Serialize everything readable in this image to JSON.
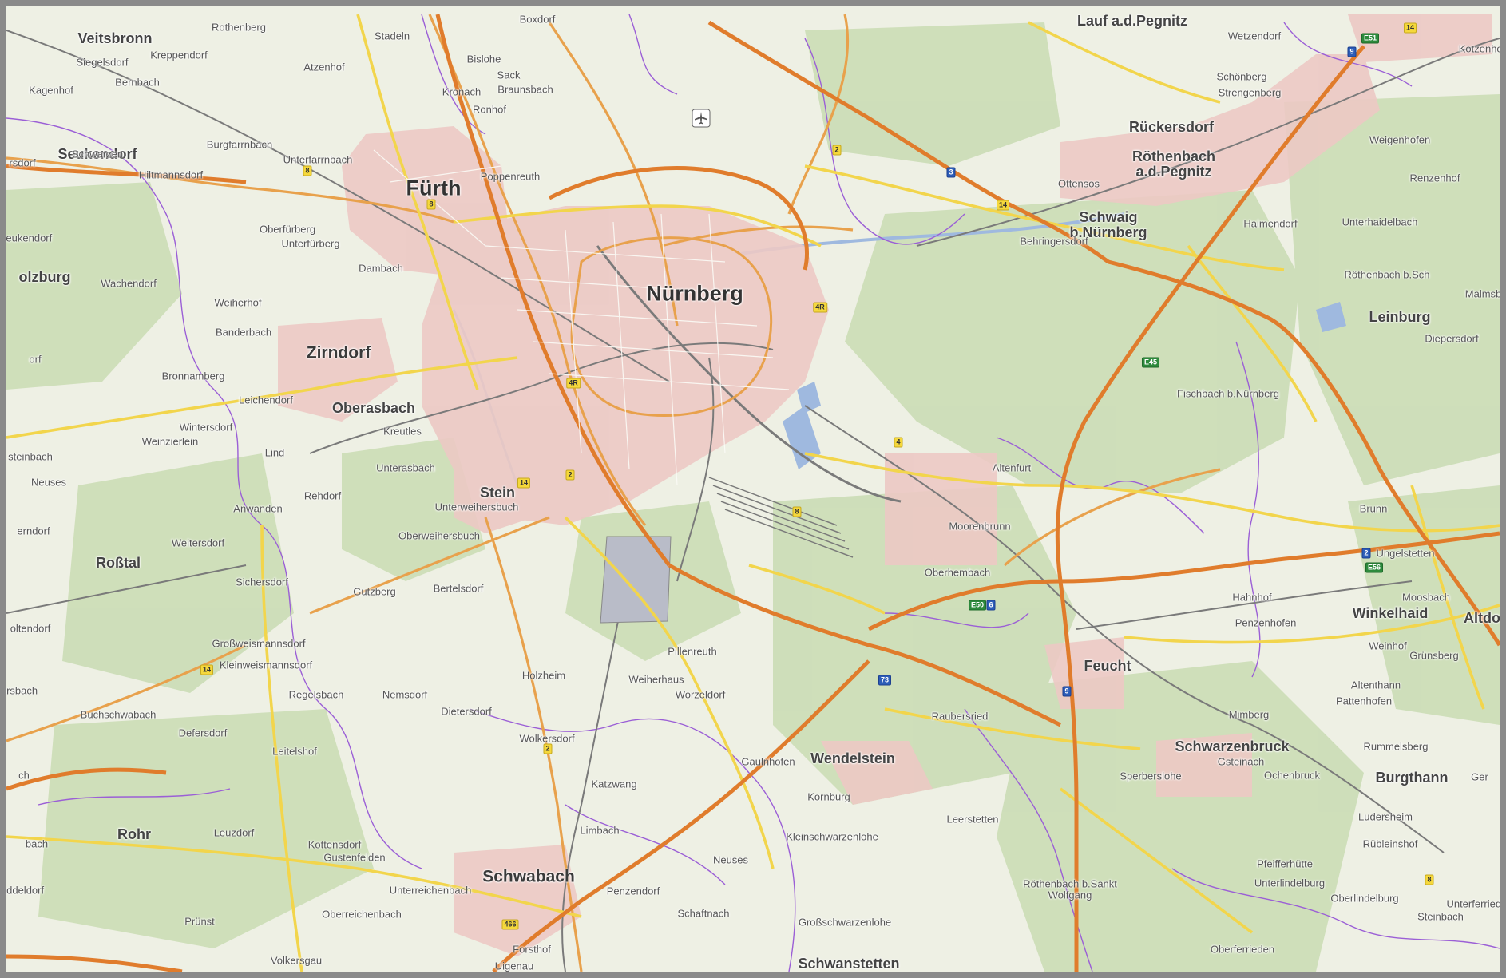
{
  "map": {
    "colors": {
      "background": "#eef0e4",
      "forest": "#c9dcb3",
      "urban": "#ecc9c4",
      "motorway": "#e07c2c",
      "primary_road": "#f2d54c",
      "secondary_road": "#e8a14c",
      "railway": "#7a7a7a",
      "water": "#9fb9df",
      "boundary": "#9b5fd6",
      "frame": "#8a8a8a"
    },
    "labels": [
      {
        "text": "Nürnberg",
        "kind": "city-big"
      },
      {
        "text": "Fürth",
        "kind": "city-big"
      },
      {
        "text": "Zirndorf",
        "kind": "city"
      },
      {
        "text": "Schwabach",
        "kind": "city"
      },
      {
        "text": "Oberasbach",
        "kind": "town"
      },
      {
        "text": "Stein",
        "kind": "town"
      },
      {
        "text": "Roßtal",
        "kind": "town"
      },
      {
        "text": "Feucht",
        "kind": "town"
      },
      {
        "text": "Wendelstein",
        "kind": "town"
      },
      {
        "text": "Schwarzenbruck",
        "kind": "town"
      },
      {
        "text": "Burgthann",
        "kind": "town"
      },
      {
        "text": "Leinburg",
        "kind": "town"
      },
      {
        "text": "Schwanstetten",
        "kind": "town"
      },
      {
        "text": "Veitsbronn",
        "kind": "town"
      },
      {
        "text": "Lauf a.d.Pegnitz",
        "kind": "town"
      },
      {
        "text": "Röthenbach\na.d.Pegnitz",
        "kind": "town"
      },
      {
        "text": "Schwaig\nb.Nürnberg",
        "kind": "town"
      },
      {
        "text": "Rückersdorf",
        "kind": "town"
      },
      {
        "text": "Seukendorf",
        "kind": "town"
      },
      {
        "text": "Winkelhaid",
        "kind": "town"
      },
      {
        "text": "Rohr",
        "kind": "town"
      },
      {
        "text": "olzburg",
        "kind": "town"
      },
      {
        "text": "Altdo",
        "kind": "town"
      },
      {
        "text": "Rothenberg",
        "kind": "village"
      },
      {
        "text": "Stadeln",
        "kind": "village"
      },
      {
        "text": "Boxdorf",
        "kind": "village"
      },
      {
        "text": "Bislohe",
        "kind": "village"
      },
      {
        "text": "Sack",
        "kind": "village"
      },
      {
        "text": "Braunsbach",
        "kind": "village"
      },
      {
        "text": "Kronach",
        "kind": "village"
      },
      {
        "text": "Ronhof",
        "kind": "village"
      },
      {
        "text": "Atzenhof",
        "kind": "village"
      },
      {
        "text": "Siegelsdorf",
        "kind": "village"
      },
      {
        "text": "Kreppendorf",
        "kind": "village"
      },
      {
        "text": "Bernbach",
        "kind": "village"
      },
      {
        "text": "Kagenhof",
        "kind": "village"
      },
      {
        "text": "Burgfarrnbach",
        "kind": "village"
      },
      {
        "text": "Unterfarrnbach",
        "kind": "village"
      },
      {
        "text": "Poppenreuth",
        "kind": "village"
      },
      {
        "text": "Hiltmannsdorf",
        "kind": "village"
      },
      {
        "text": "Oberfürberg",
        "kind": "village"
      },
      {
        "text": "Unterfürberg",
        "kind": "village"
      },
      {
        "text": "Dambach",
        "kind": "village"
      },
      {
        "text": "Wachendorf",
        "kind": "village"
      },
      {
        "text": "Weiherhof",
        "kind": "village"
      },
      {
        "text": "Banderbach",
        "kind": "village"
      },
      {
        "text": "Bronnamberg",
        "kind": "village"
      },
      {
        "text": "Leichendorf",
        "kind": "village"
      },
      {
        "text": "Wintersdorf",
        "kind": "village"
      },
      {
        "text": "Weinzierlein",
        "kind": "village"
      },
      {
        "text": "Kreutles",
        "kind": "village"
      },
      {
        "text": "Lind",
        "kind": "village"
      },
      {
        "text": "Unterasbach",
        "kind": "village"
      },
      {
        "text": "Rehdorf",
        "kind": "village"
      },
      {
        "text": "Unterweihersbuch",
        "kind": "village"
      },
      {
        "text": "Oberweihersbuch",
        "kind": "village"
      },
      {
        "text": "Anwanden",
        "kind": "village"
      },
      {
        "text": "Neuses",
        "kind": "village"
      },
      {
        "text": "Weitersdorf",
        "kind": "village"
      },
      {
        "text": "Sichersdorf",
        "kind": "village"
      },
      {
        "text": "Gutzberg",
        "kind": "village"
      },
      {
        "text": "Bertelsdorf",
        "kind": "village"
      },
      {
        "text": "Großweismannsdorf",
        "kind": "village"
      },
      {
        "text": "Kleinweismannsdorf",
        "kind": "village"
      },
      {
        "text": "Regelsbach",
        "kind": "village"
      },
      {
        "text": "Nemsdorf",
        "kind": "village"
      },
      {
        "text": "Dietersdorf",
        "kind": "village"
      },
      {
        "text": "Buchschwabach",
        "kind": "village"
      },
      {
        "text": "Defersdorf",
        "kind": "village"
      },
      {
        "text": "Leitelshof",
        "kind": "village"
      },
      {
        "text": "Leuzdorf",
        "kind": "village"
      },
      {
        "text": "Kottensdorf",
        "kind": "village"
      },
      {
        "text": "Gustenfelden",
        "kind": "village"
      },
      {
        "text": "Unterreichenbach",
        "kind": "village"
      },
      {
        "text": "Oberreichenbach",
        "kind": "village"
      },
      {
        "text": "Prünst",
        "kind": "village"
      },
      {
        "text": "Volkersgau",
        "kind": "village"
      },
      {
        "text": "Forsthof",
        "kind": "village"
      },
      {
        "text": "Uigenau",
        "kind": "village"
      },
      {
        "text": "Penzendorf",
        "kind": "village"
      },
      {
        "text": "Schaftnach",
        "kind": "village"
      },
      {
        "text": "Neuses",
        "kind": "village"
      },
      {
        "text": "Limbach",
        "kind": "village"
      },
      {
        "text": "Katzwang",
        "kind": "village"
      },
      {
        "text": "Wolkersdorf",
        "kind": "village"
      },
      {
        "text": "Holzheim",
        "kind": "village"
      },
      {
        "text": "Weiherhaus",
        "kind": "village"
      },
      {
        "text": "Pillenreuth",
        "kind": "village"
      },
      {
        "text": "Worzeldorf",
        "kind": "village"
      },
      {
        "text": "Gaulnhofen",
        "kind": "village"
      },
      {
        "text": "Kornburg",
        "kind": "village"
      },
      {
        "text": "Kleinschwarzenlohe",
        "kind": "village"
      },
      {
        "text": "Großschwarzenlohe",
        "kind": "village"
      },
      {
        "text": "Leerstetten",
        "kind": "village"
      },
      {
        "text": "Raubersried",
        "kind": "village"
      },
      {
        "text": "Röthenbach b.Sankt\nWolfgang",
        "kind": "village"
      },
      {
        "text": "Sperberslohe",
        "kind": "village"
      },
      {
        "text": "Gsteinach",
        "kind": "village"
      },
      {
        "text": "Ochenbruck",
        "kind": "village"
      },
      {
        "text": "Mimberg",
        "kind": "village"
      },
      {
        "text": "Rummelsberg",
        "kind": "village"
      },
      {
        "text": "Pattenhofen",
        "kind": "village"
      },
      {
        "text": "Altenthann",
        "kind": "village"
      },
      {
        "text": "Grünsberg",
        "kind": "village"
      },
      {
        "text": "Weinhof",
        "kind": "village"
      },
      {
        "text": "Penzenhofen",
        "kind": "village"
      },
      {
        "text": "Hahnhof",
        "kind": "village"
      },
      {
        "text": "Moosbach",
        "kind": "village"
      },
      {
        "text": "Ludersheim",
        "kind": "village"
      },
      {
        "text": "Rübleinshof",
        "kind": "village"
      },
      {
        "text": "Pfeifferhütte",
        "kind": "village"
      },
      {
        "text": "Unterlindelburg",
        "kind": "village"
      },
      {
        "text": "Oberlindelburg",
        "kind": "village"
      },
      {
        "text": "Unterferrieden",
        "kind": "village"
      },
      {
        "text": "Steinbach",
        "kind": "village"
      },
      {
        "text": "Oberferrieden",
        "kind": "village"
      },
      {
        "text": "Oberhembach",
        "kind": "village"
      },
      {
        "text": "Moorenbrunn",
        "kind": "village"
      },
      {
        "text": "Altenfurt",
        "kind": "village"
      },
      {
        "text": "Fischbach b.Nürnberg",
        "kind": "village"
      },
      {
        "text": "Brunn",
        "kind": "village"
      },
      {
        "text": "Ungelstetten",
        "kind": "village"
      },
      {
        "text": "Röthenbach b.Sch",
        "kind": "village"
      },
      {
        "text": "Diepersdorf",
        "kind": "village"
      },
      {
        "text": "Unterhaidelbach",
        "kind": "village"
      },
      {
        "text": "Haimendorf",
        "kind": "village"
      },
      {
        "text": "Renzenhof",
        "kind": "village"
      },
      {
        "text": "Weigenhofen",
        "kind": "village"
      },
      {
        "text": "Schönberg",
        "kind": "village"
      },
      {
        "text": "Strengenberg",
        "kind": "village"
      },
      {
        "text": "Wetzendorf",
        "kind": "village"
      },
      {
        "text": "Kotzenhof",
        "kind": "village"
      },
      {
        "text": "Ottensos",
        "kind": "village"
      },
      {
        "text": "Behringersdorf",
        "kind": "village"
      },
      {
        "text": "Malmsbach",
        "kind": "village"
      },
      {
        "text": "Ger",
        "kind": "village"
      },
      {
        "text": "Schwarzen",
        "kind": "village"
      },
      {
        "text": "Seukendorf",
        "kind": "village"
      },
      {
        "text": "rsdorf",
        "kind": "village"
      },
      {
        "text": "orf",
        "kind": "village"
      },
      {
        "text": "steinbach",
        "kind": "village"
      },
      {
        "text": "erndorf",
        "kind": "village"
      },
      {
        "text": "oltendorf",
        "kind": "village"
      },
      {
        "text": "arsbach",
        "kind": "village"
      },
      {
        "text": "ch",
        "kind": "village"
      },
      {
        "text": "bach",
        "kind": "village"
      },
      {
        "text": "addeldorf",
        "kind": "village"
      },
      {
        "text": "endorf",
        "kind": "village"
      }
    ],
    "shields": [
      {
        "text": "8",
        "kind": "yellow"
      },
      {
        "text": "8",
        "kind": "yellow"
      },
      {
        "text": "2",
        "kind": "yellow"
      },
      {
        "text": "3",
        "kind": "blue"
      },
      {
        "text": "14",
        "kind": "yellow"
      },
      {
        "text": "9",
        "kind": "blue"
      },
      {
        "text": "E51",
        "kind": "green"
      },
      {
        "text": "14",
        "kind": "yellow"
      },
      {
        "text": "4R",
        "kind": "yellow"
      },
      {
        "text": "4R",
        "kind": "yellow"
      },
      {
        "text": "4",
        "kind": "yellow"
      },
      {
        "text": "14",
        "kind": "yellow"
      },
      {
        "text": "2",
        "kind": "yellow"
      },
      {
        "text": "8",
        "kind": "yellow"
      },
      {
        "text": "E45",
        "kind": "green"
      },
      {
        "text": "E50",
        "kind": "green"
      },
      {
        "text": "6",
        "kind": "blue"
      },
      {
        "text": "73",
        "kind": "blue"
      },
      {
        "text": "9",
        "kind": "blue"
      },
      {
        "text": "2",
        "kind": "yellow"
      },
      {
        "text": "14",
        "kind": "yellow"
      },
      {
        "text": "2",
        "kind": "blue"
      },
      {
        "text": "E56",
        "kind": "green"
      },
      {
        "text": "466",
        "kind": "yellow"
      },
      {
        "text": "8",
        "kind": "yellow"
      }
    ]
  }
}
